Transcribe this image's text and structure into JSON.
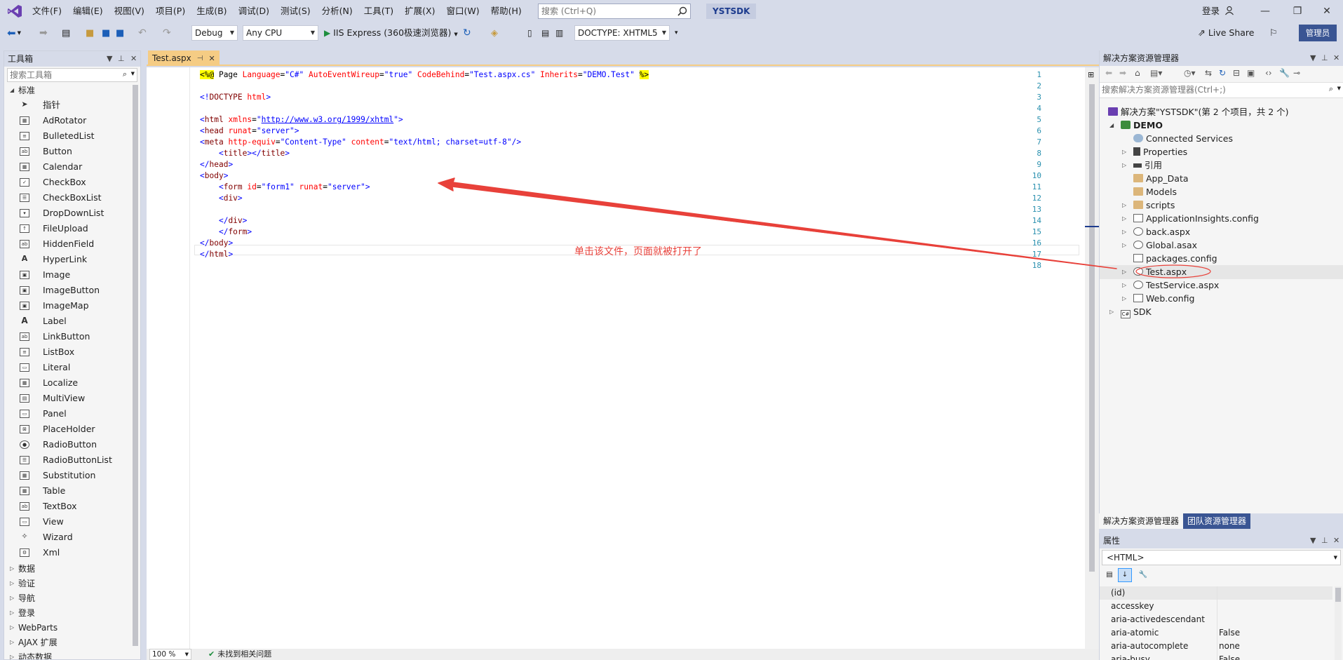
{
  "menu": [
    "文件(F)",
    "编辑(E)",
    "视图(V)",
    "项目(P)",
    "生成(B)",
    "调试(D)",
    "测试(S)",
    "分析(N)",
    "工具(T)",
    "扩展(X)",
    "窗口(W)",
    "帮助(H)"
  ],
  "search": {
    "placeholder": "搜索 (Ctrl+Q)"
  },
  "solution_badge": "YSTSDK",
  "login": "登录",
  "toolbar": {
    "config": "Debug",
    "platform": "Any CPU",
    "run_label": "IIS Express (360极速浏览器)",
    "doctype": "DOCTYPE: XHTML5",
    "live_share": "Live Share",
    "admin": "管理员"
  },
  "toolbox": {
    "title": "工具箱",
    "search_placeholder": "搜索工具箱",
    "group_standard": "标准",
    "items": [
      "指针",
      "AdRotator",
      "BulletedList",
      "Button",
      "Calendar",
      "CheckBox",
      "CheckBoxList",
      "DropDownList",
      "FileUpload",
      "HiddenField",
      "HyperLink",
      "Image",
      "ImageButton",
      "ImageMap",
      "Label",
      "LinkButton",
      "ListBox",
      "Literal",
      "Localize",
      "MultiView",
      "Panel",
      "PlaceHolder",
      "RadioButton",
      "RadioButtonList",
      "Substitution",
      "Table",
      "TextBox",
      "View",
      "Wizard",
      "Xml"
    ],
    "groups": [
      "数据",
      "验证",
      "导航",
      "登录",
      "WebParts",
      "AJAX 扩展",
      "动态数据"
    ]
  },
  "editor": {
    "tab": "Test.aspx",
    "line_numbers": [
      "1",
      "2",
      "3",
      "4",
      "5",
      "6",
      "7",
      "8",
      "9",
      "10",
      "11",
      "12",
      "13",
      "14",
      "15",
      "16",
      "17",
      "18"
    ],
    "zoom": "100 %",
    "status": "未找到相关问题"
  },
  "annotation": "单击该文件，页面就被打开了",
  "solution_explorer": {
    "title": "解决方案资源管理器",
    "search_placeholder": "搜索解决方案资源管理器(Ctrl+;)",
    "solution": "解决方案\"YSTSDK\"(第 2 个项目，共 2 个)",
    "project": "DEMO",
    "items": [
      "Connected Services",
      "Properties",
      "引用",
      "App_Data",
      "Models",
      "scripts",
      "ApplicationInsights.config",
      "back.aspx",
      "Global.asax",
      "packages.config",
      "Test.aspx",
      "TestService.aspx",
      "Web.config"
    ],
    "project2": "SDK",
    "tabs": [
      "解决方案资源管理器",
      "团队资源管理器"
    ]
  },
  "properties": {
    "title": "属性",
    "object": "<HTML>",
    "rows": [
      {
        "name": "(id)",
        "value": ""
      },
      {
        "name": "accesskey",
        "value": ""
      },
      {
        "name": "aria-activedescendant",
        "value": ""
      },
      {
        "name": "aria-atomic",
        "value": "False"
      },
      {
        "name": "aria-autocomplete",
        "value": "none"
      },
      {
        "name": "aria-busy",
        "value": "False"
      }
    ]
  },
  "colors": {
    "accent": "#3a5593",
    "chrome": "#d6dbe9",
    "tab": "#f5cc84",
    "annotation": "#e8413a"
  }
}
